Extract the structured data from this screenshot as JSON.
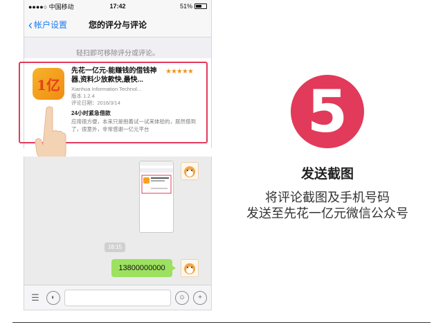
{
  "statusbar": {
    "carrier": "●●●●○ 中国移动",
    "time": "17:42",
    "battery": "51%"
  },
  "navbar": {
    "back_label": "帐户设置",
    "title": "您的评分与评论"
  },
  "hint": "轻扫即可移除评分或评论。",
  "review": {
    "app_icon_text": "1亿",
    "app_name": "先花一亿元-能赚钱的借钱神器,资料少放款快,最快...",
    "stars": "★★★★★",
    "developer": "Xianhua Information Technol...",
    "version": "版本 1.2.4",
    "date": "评论日期：2016/3/14",
    "title": "24小时紧急借款",
    "body": "应用很方便，本来只是抱着试一试来体验的，居然借到了，很意外，非常感谢一亿元平台"
  },
  "chat": {
    "timestamp": "18:15",
    "message": "13800000000"
  },
  "step": {
    "number": "5",
    "title": "发送截图",
    "desc_line1": "将评论截图及手机号码",
    "desc_line2": "发送至先花一亿元微信公众号"
  },
  "colors": {
    "accent": "#e23a5a",
    "ios_blue": "#1a7cf0",
    "chat_green": "#9de160",
    "stars": "#f0941c"
  },
  "icons": [
    "back-chevron-icon",
    "tap-hand-icon",
    "voice-icon",
    "list-menu-icon",
    "emoji-icon",
    "plus-icon",
    "shiba-avatar-icon"
  ]
}
